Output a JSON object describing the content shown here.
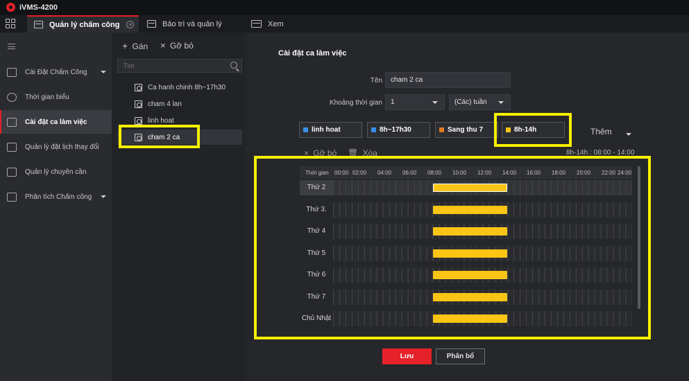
{
  "app": {
    "title": "iVMS-4200"
  },
  "tabs": [
    {
      "label": "Quản lý chấm công"
    },
    {
      "label": "Bảo trì và quản lý"
    },
    {
      "label": "Xem"
    }
  ],
  "leftnav": {
    "items": [
      {
        "label": "Cài Đặt Chấm Công"
      },
      {
        "label": "Thời gian biểu"
      },
      {
        "label": "Cài đặt ca làm việc"
      },
      {
        "label": "Quản lý đặt lịch thay đổi"
      },
      {
        "label": "Quản lý chuyên cần"
      },
      {
        "label": "Phân tích Chấm công"
      }
    ]
  },
  "list": {
    "add_label": "Gán",
    "remove_label": "Gỡ bỏ",
    "search_placeholder": "Tìm",
    "items": [
      {
        "label": "Ca hanh chinh 8h~17h30"
      },
      {
        "label": "cham 4 lan"
      },
      {
        "label": "linh hoat"
      },
      {
        "label": "cham 2 ca"
      }
    ]
  },
  "main": {
    "title": "Cài đặt ca làm việc",
    "name_label": "Tên",
    "name_value": "cham 2 ca",
    "period_label": "Khoảng thời gian",
    "period_value": "1",
    "unit_value": "(Các) tuần",
    "shift_types": [
      {
        "label": "linh hoat",
        "color": "#3a8ee6"
      },
      {
        "label": "8h~17h30",
        "color": "#3a8ee6"
      },
      {
        "label": "Sang thu 7",
        "color": "#e07a22"
      },
      {
        "label": "8h-14h",
        "color": "#fac514"
      }
    ],
    "more_label": "Thêm",
    "remove_label": "Gỡ bỏ",
    "delete_label": "Xóa",
    "range_text": "8h-14h : 08:00 - 14:00"
  },
  "schedule": {
    "header_label": "Thời gian",
    "time_labels": [
      "00:00",
      "02:00",
      "04:00",
      "06:00",
      "08:00",
      "10:00",
      "12:00",
      "14:00",
      "16:00",
      "18:00",
      "20:00",
      "22:00",
      "24:00"
    ],
    "days": [
      {
        "label": "Thứ 2"
      },
      {
        "label": "Thứ 3."
      },
      {
        "label": "Thứ 4"
      },
      {
        "label": "Thứ 5"
      },
      {
        "label": "Thứ 6"
      },
      {
        "label": "Thứ 7"
      },
      {
        "label": "Chủ Nhật"
      }
    ],
    "shift": {
      "start": "08:00",
      "end": "14:00"
    }
  },
  "buttons": {
    "save": "Lưu",
    "assign": "Phân bổ"
  }
}
